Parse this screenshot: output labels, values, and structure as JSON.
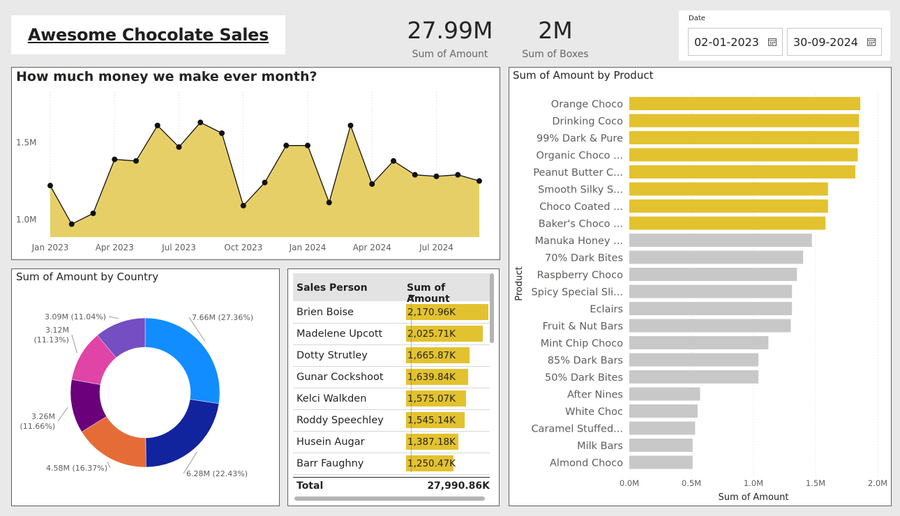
{
  "title": "Awesome Chocolate Sales",
  "kpis": {
    "amount": {
      "value": "27.99M",
      "label": "Sum of Amount"
    },
    "boxes": {
      "value": "2M",
      "label": "Sum of Boxes"
    }
  },
  "date_slicer": {
    "label": "Date",
    "start": "02-01-2023",
    "end": "30-09-2024",
    "icon": "calendar-icon"
  },
  "colors": {
    "gold": "#e3c22f",
    "area": "#e7cf68",
    "grey_bar": "#c8c8c8",
    "donut": [
      "#118dff",
      "#12239e",
      "#e66c37",
      "#6b007b",
      "#e044a7",
      "#744ec2"
    ]
  },
  "line_chart": {
    "title": "How much money we make ever month?",
    "y_ticks": [
      "1.0M",
      "1.5M"
    ],
    "x_ticks": [
      "Jan 2023",
      "Apr 2023",
      "Jul 2023",
      "Oct 2023",
      "Jan 2024",
      "Apr 2024",
      "Jul 2024"
    ]
  },
  "donut_chart": {
    "title": "Sum of Amount by Country"
  },
  "table": {
    "headers": [
      "Sales Person",
      "Sum of Amount"
    ],
    "rows": [
      {
        "name": "Brien Boise",
        "value": "2,170.96K",
        "amount": 2170.96
      },
      {
        "name": "Madelene Upcott",
        "value": "2,025.71K",
        "amount": 2025.71
      },
      {
        "name": "Dotty Strutley",
        "value": "1,665.87K",
        "amount": 1665.87
      },
      {
        "name": "Gunar Cockshoot",
        "value": "1,639.84K",
        "amount": 1639.84
      },
      {
        "name": "Kelci Walkden",
        "value": "1,575.07K",
        "amount": 1575.07
      },
      {
        "name": "Roddy Speechley",
        "value": "1,545.14K",
        "amount": 1545.14
      },
      {
        "name": "Husein Augar",
        "value": "1,387.18K",
        "amount": 1387.18
      },
      {
        "name": "Barr Faughny",
        "value": "1,250.47K",
        "amount": 1250.47
      }
    ],
    "total_label": "Total",
    "total_value": "27,990.86K"
  },
  "product_chart": {
    "title": "Sum of Amount by Product"
  },
  "chart_data": [
    {
      "type": "area",
      "title": "How much money we make ever month?",
      "xlabel": "",
      "ylabel": "",
      "x": [
        "2023-01",
        "2023-02",
        "2023-03",
        "2023-04",
        "2023-05",
        "2023-06",
        "2023-07",
        "2023-08",
        "2023-09",
        "2023-10",
        "2023-11",
        "2023-12",
        "2024-01",
        "2024-02",
        "2024-03",
        "2024-04",
        "2024-05",
        "2024-06",
        "2024-07",
        "2024-08",
        "2024-09"
      ],
      "values": [
        1.22,
        0.97,
        1.04,
        1.39,
        1.38,
        1.61,
        1.47,
        1.63,
        1.56,
        1.09,
        1.24,
        1.48,
        1.48,
        1.11,
        1.61,
        1.23,
        1.38,
        1.29,
        1.28,
        1.29,
        1.25
      ],
      "unit": "M",
      "ylim": [
        0.8,
        1.75
      ],
      "grid": "vertical dotted",
      "markers": true
    },
    {
      "type": "pie",
      "title": "Sum of Amount by Country",
      "donut": true,
      "values": [
        7.66,
        6.28,
        4.58,
        3.26,
        3.12,
        3.09
      ],
      "labels": [
        "7.66M (27.36%)",
        "6.28M (22.43%)",
        "4.58M (16.37%)",
        "3.26M (11.66%)",
        "3.12M (11.13%)",
        "3.09M (11.04%)"
      ],
      "legend": "none"
    },
    {
      "type": "bar",
      "orientation": "horizontal",
      "title": "Sum of Amount by Product",
      "xlabel": "Sum of Amount",
      "ylabel": "Product",
      "xlim": [
        0,
        2.0
      ],
      "x_ticks": [
        "0.0M",
        "0.5M",
        "1.0M",
        "1.5M",
        "2.0M"
      ],
      "categories": [
        "Orange Choco",
        "Drinking Coco",
        "99% Dark & Pure",
        "Organic Choco ...",
        "Peanut Butter C...",
        "Smooth Silky S...",
        "Choco Coated ...",
        "Baker's Choco ...",
        "Manuka Honey ...",
        "70% Dark Bites",
        "Raspberry Choco",
        "Spicy Special Sli...",
        "Eclairs",
        "Fruit & Nut Bars",
        "Mint Chip Choco",
        "85% Dark Bars",
        "50% Dark Bites",
        "After Nines",
        "White Choc",
        "Caramel Stuffed...",
        "Milk Bars",
        "Almond Choco"
      ],
      "values": [
        1.86,
        1.85,
        1.85,
        1.84,
        1.82,
        1.6,
        1.6,
        1.58,
        1.47,
        1.4,
        1.35,
        1.31,
        1.31,
        1.3,
        1.12,
        1.04,
        1.04,
        0.57,
        0.55,
        0.53,
        0.51,
        0.51
      ],
      "highlighted_count": 8,
      "grid": "vertical dotted"
    }
  ]
}
